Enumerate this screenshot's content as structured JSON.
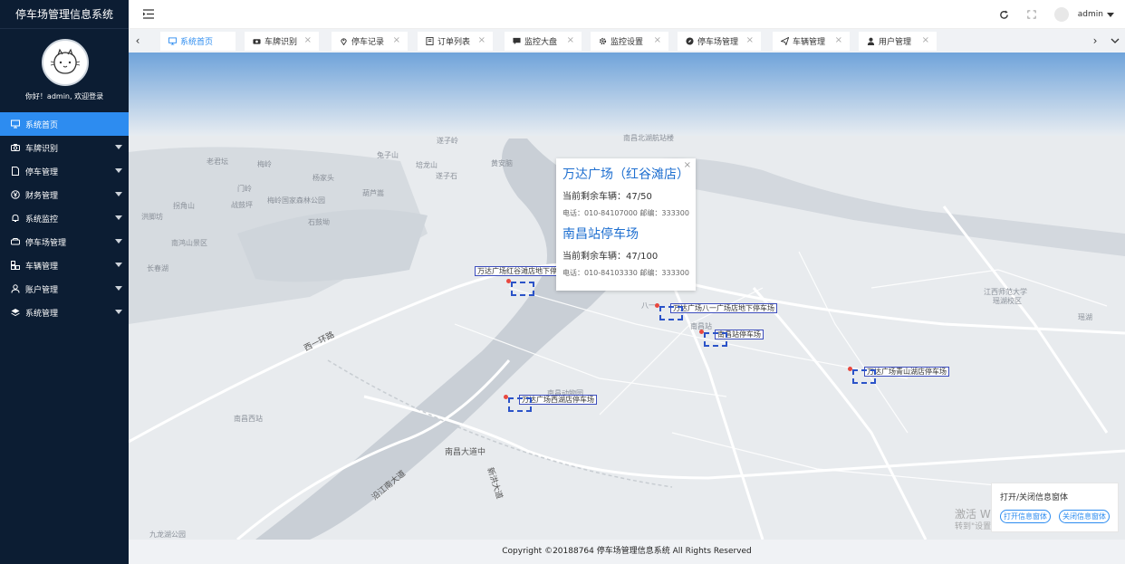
{
  "app": {
    "title": "停车场管理信息系统"
  },
  "user": {
    "greeting": "你好！admin, 欢迎登录",
    "name": "admin"
  },
  "sidebar": {
    "items": [
      {
        "label": "系统首页",
        "icon": "monitor-icon"
      },
      {
        "label": "车牌识别",
        "icon": "camera-icon"
      },
      {
        "label": "停车管理",
        "icon": "document-icon"
      },
      {
        "label": "财务管理",
        "icon": "yen-icon"
      },
      {
        "label": "系统监控",
        "icon": "bell-icon"
      },
      {
        "label": "停车场管理",
        "icon": "parking-icon"
      },
      {
        "label": "车辆管理",
        "icon": "vehicle-icon"
      },
      {
        "label": "账户管理",
        "icon": "user-icon"
      },
      {
        "label": "系统管理",
        "icon": "layers-icon"
      }
    ]
  },
  "tabs": [
    {
      "label": "系统首页"
    },
    {
      "label": "车牌识别"
    },
    {
      "label": "停车记录"
    },
    {
      "label": "订单列表"
    },
    {
      "label": "监控大盘"
    },
    {
      "label": "监控设置"
    },
    {
      "label": "停车场管理"
    },
    {
      "label": "车辆管理"
    },
    {
      "label": "用户管理"
    }
  ],
  "map": {
    "places": [
      "遂子岭",
      "南昌北湖航站楼",
      "老君坛",
      "兔子山",
      "培龙山",
      "黄安脑",
      "梅岭",
      "杨家头",
      "遂子石",
      "门岭",
      "拐角山",
      "战鼓坪",
      "梅岭国家森林公园",
      "葫芦嵩",
      "洪脚坊",
      "石鼓坳",
      "南鸿山景区",
      "长春湖",
      "江西师范大学",
      "瑶湖校区",
      "八一",
      "南昌站",
      "南昌动物园",
      "南昌西站",
      "九龙湖公园",
      "瑶湖"
    ],
    "roads": [
      "西一环路",
      "南昌大道中",
      "沿江南大道",
      "新洪大道"
    ],
    "markers": [
      {
        "label": "万达广场红谷滩店地下停车场"
      },
      {
        "label": "万达广场八一广场店地下停车场"
      },
      {
        "label": "南昌站停车场"
      },
      {
        "label": "万达广场青山湖店停车场"
      },
      {
        "label": "万达广场西湖店停车场"
      }
    ],
    "popup": {
      "entries": [
        {
          "title": "万达广场（红谷滩店）",
          "remaining": "当前剩余车辆：47/50",
          "contact": "电话：010-84107000 邮编：333300"
        },
        {
          "title": "南昌站停车场",
          "remaining": "当前剩余车辆：47/100",
          "contact": "电话：010-84103330 邮编：333300"
        }
      ]
    },
    "info_box": {
      "title": "打开/关闭信息窗体",
      "open_label": "打开信息窗体",
      "close_label": "关闭信息窗体"
    },
    "watermark": {
      "line1": "激活 Windows",
      "line2": "转到\"设置\"以激活 Windows。"
    }
  },
  "footer": {
    "text": "Copyright ©20188764 停车场管理信息系统 All Rights Reserved"
  },
  "colors": {
    "sidebar_bg": "#0c1d33",
    "accent": "#2d8cf0",
    "marker_border": "#3c4dbd",
    "pin": "#e8483f"
  }
}
